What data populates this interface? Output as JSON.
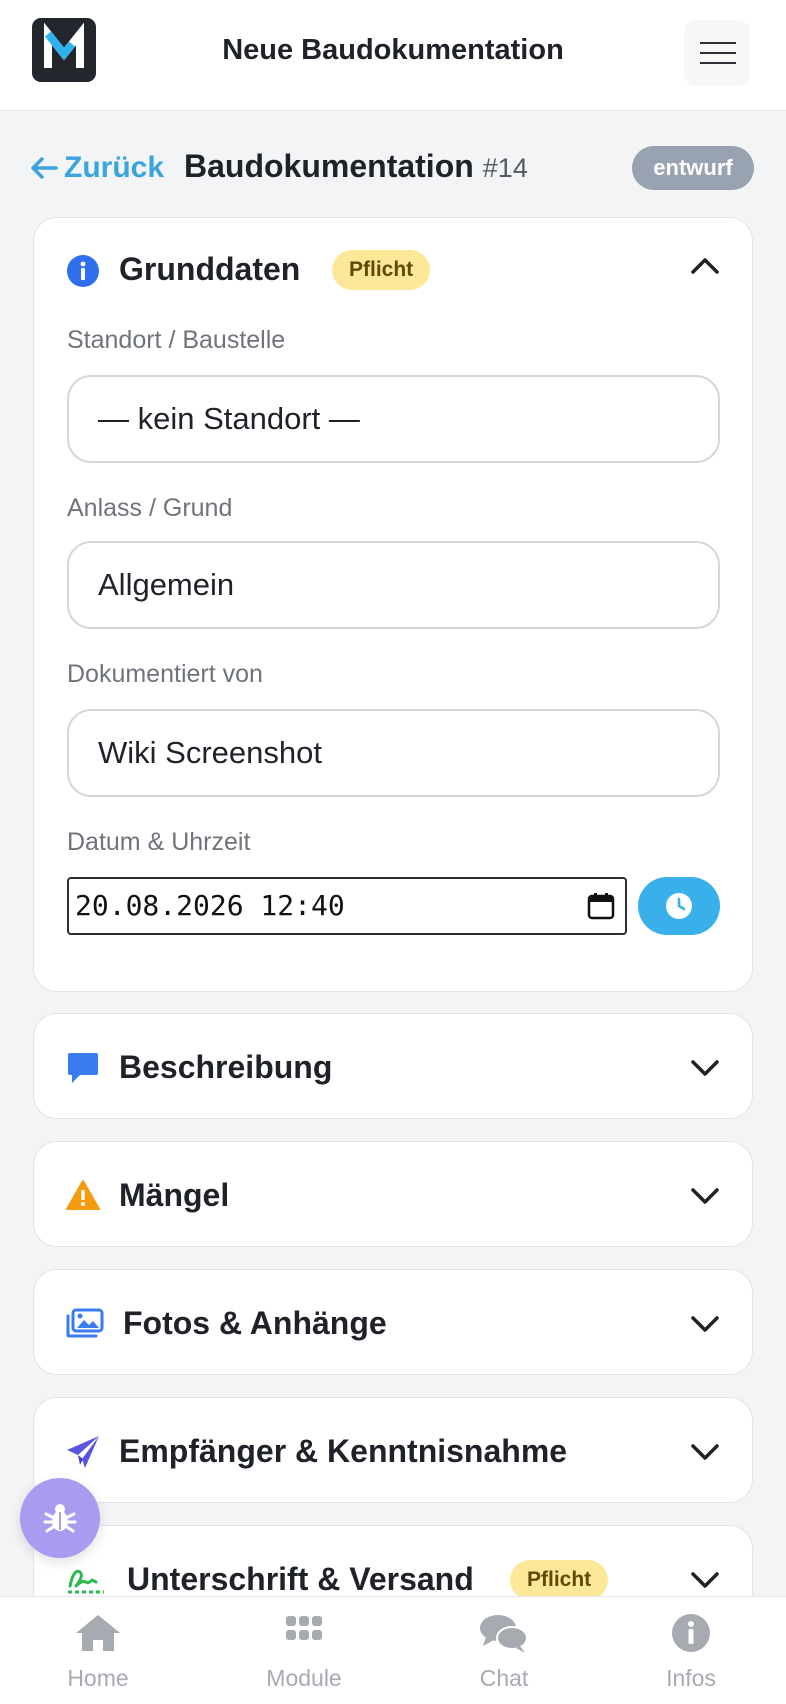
{
  "header": {
    "app_title": "Neue Baudokumentation",
    "logo_letter": "M"
  },
  "subheader": {
    "back_label": "Zurück",
    "title": "Baudokumentation",
    "number": "#14",
    "status": "entwurf"
  },
  "sections": {
    "grunddaten": {
      "title": "Grunddaten",
      "badge": "Pflicht",
      "expanded": true,
      "fields": {
        "standort": {
          "label": "Standort / Baustelle",
          "value": "— kein Standort —"
        },
        "anlass": {
          "label": "Anlass / Grund",
          "value": "Allgemein"
        },
        "dokumentiert": {
          "label": "Dokumentiert von",
          "value": "Wiki Screenshot"
        },
        "datum": {
          "label": "Datum & Uhrzeit",
          "value": "20.08.2026 12:40"
        }
      }
    },
    "beschreibung": {
      "title": "Beschreibung"
    },
    "maengel": {
      "title": "Mängel"
    },
    "fotos": {
      "title": "Fotos & Anhänge"
    },
    "empfaenger": {
      "title": "Empfänger & Kenntnisnahme"
    },
    "unterschrift": {
      "title": "Unterschrift & Versand",
      "badge": "Pflicht"
    }
  },
  "bottom_nav": {
    "home": "Home",
    "module": "Module",
    "chat": "Chat",
    "infos": "Infos"
  },
  "colors": {
    "accent": "#3ab0ea",
    "status_badge": "#98a2b1",
    "pflicht_bg": "#fde89a",
    "fab": "#a99bf0"
  },
  "icons": {
    "logo": "m-logo-icon",
    "menu": "hamburger-icon",
    "back": "arrow-left-icon",
    "grunddaten": "info-circle-icon",
    "beschreibung": "comment-icon",
    "maengel": "warning-triangle-icon",
    "fotos": "images-icon",
    "empfaenger": "paper-plane-icon",
    "unterschrift": "signature-icon",
    "fab": "bug-icon"
  }
}
